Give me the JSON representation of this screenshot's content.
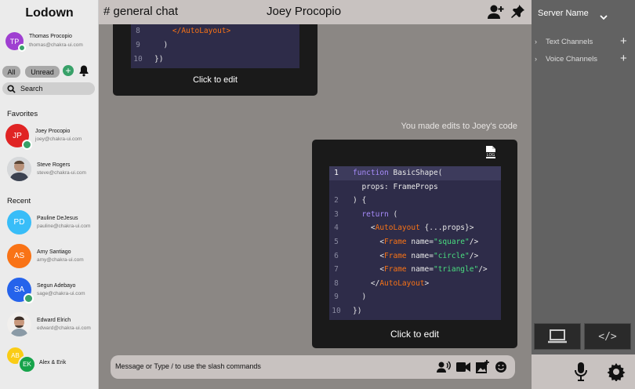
{
  "app": {
    "title": "Lodown"
  },
  "current_user": {
    "initials": "TP",
    "name": "Thomas Procopio",
    "email": "thomas@chakra-ui.com",
    "color": "#9f3fd1"
  },
  "filters": {
    "all": "All",
    "unread": "Unread"
  },
  "search": {
    "label": "Search"
  },
  "favorites": {
    "heading": "Favorites",
    "items": [
      {
        "initials": "JP",
        "name": "Joey Procopio",
        "email": "joey@chakra-ui.com",
        "color": "#e02424",
        "online": true
      },
      {
        "initials": "",
        "name": "Steve Rogers",
        "email": "steve@chakra-ui.com",
        "color": "#7a6a5c",
        "online": false
      }
    ]
  },
  "recent": {
    "heading": "Recent",
    "items": [
      {
        "initials": "PD",
        "name": "Pauline DeJesus",
        "email": "pauline@chakra-ui.com",
        "color": "#38bdf8",
        "online": false
      },
      {
        "initials": "AS",
        "name": "Amy Santiago",
        "email": "amy@chakra-ui.com",
        "color": "#f97316",
        "online": false
      },
      {
        "initials": "SA",
        "name": "Segun Adebayo",
        "email": "sage@chakra-ui.com",
        "color": "#2563eb",
        "online": true
      },
      {
        "initials": "",
        "name": "Edward Elrich",
        "email": "edward@chakra-ui.com",
        "color": "#b98e76",
        "online": false
      }
    ]
  },
  "group": {
    "initials1": "AB",
    "initials2": "EK",
    "name": "Alex & Erik",
    "color1": "#facc15",
    "color2": "#16a34a"
  },
  "header": {
    "channel": "# general chat",
    "peer": "Joey Procopio"
  },
  "messages": {
    "top_card": {
      "lines": [
        {
          "n": "8",
          "code": "    </AutoLayout>"
        },
        {
          "n": "9",
          "code": "  )"
        },
        {
          "n": "10",
          "code": "})"
        }
      ],
      "edit_label": "Click to edit"
    },
    "note": "You made edits to Joey's code",
    "main_card": {
      "lines": [
        {
          "n": "1",
          "code": "function BasicShape("
        },
        {
          "n": "",
          "code": "  props: FrameProps"
        },
        {
          "n": "2",
          "code": ") {"
        },
        {
          "n": "3",
          "code": "  return ("
        },
        {
          "n": "4",
          "code": "    <AutoLayout {...props}>"
        },
        {
          "n": "5",
          "code": "      <Frame name=\"square\"/>"
        },
        {
          "n": "6",
          "code": "      <Frame name=\"circle\"/>"
        },
        {
          "n": "7",
          "code": "      <Frame name=\"triangle\"/>"
        },
        {
          "n": "8",
          "code": "    </AutoLayout>"
        },
        {
          "n": "9",
          "code": "  )"
        },
        {
          "n": "10",
          "code": "})"
        }
      ],
      "edit_label": "Click to edit",
      "log_label": "LOG"
    }
  },
  "composer": {
    "placeholder": "Message or Type / to use the slash commands"
  },
  "server": {
    "name": "Server Name",
    "channels": [
      {
        "label": "Text Channels"
      },
      {
        "label": "Voice Channels"
      }
    ]
  },
  "code_button": {
    "label": "</>"
  }
}
